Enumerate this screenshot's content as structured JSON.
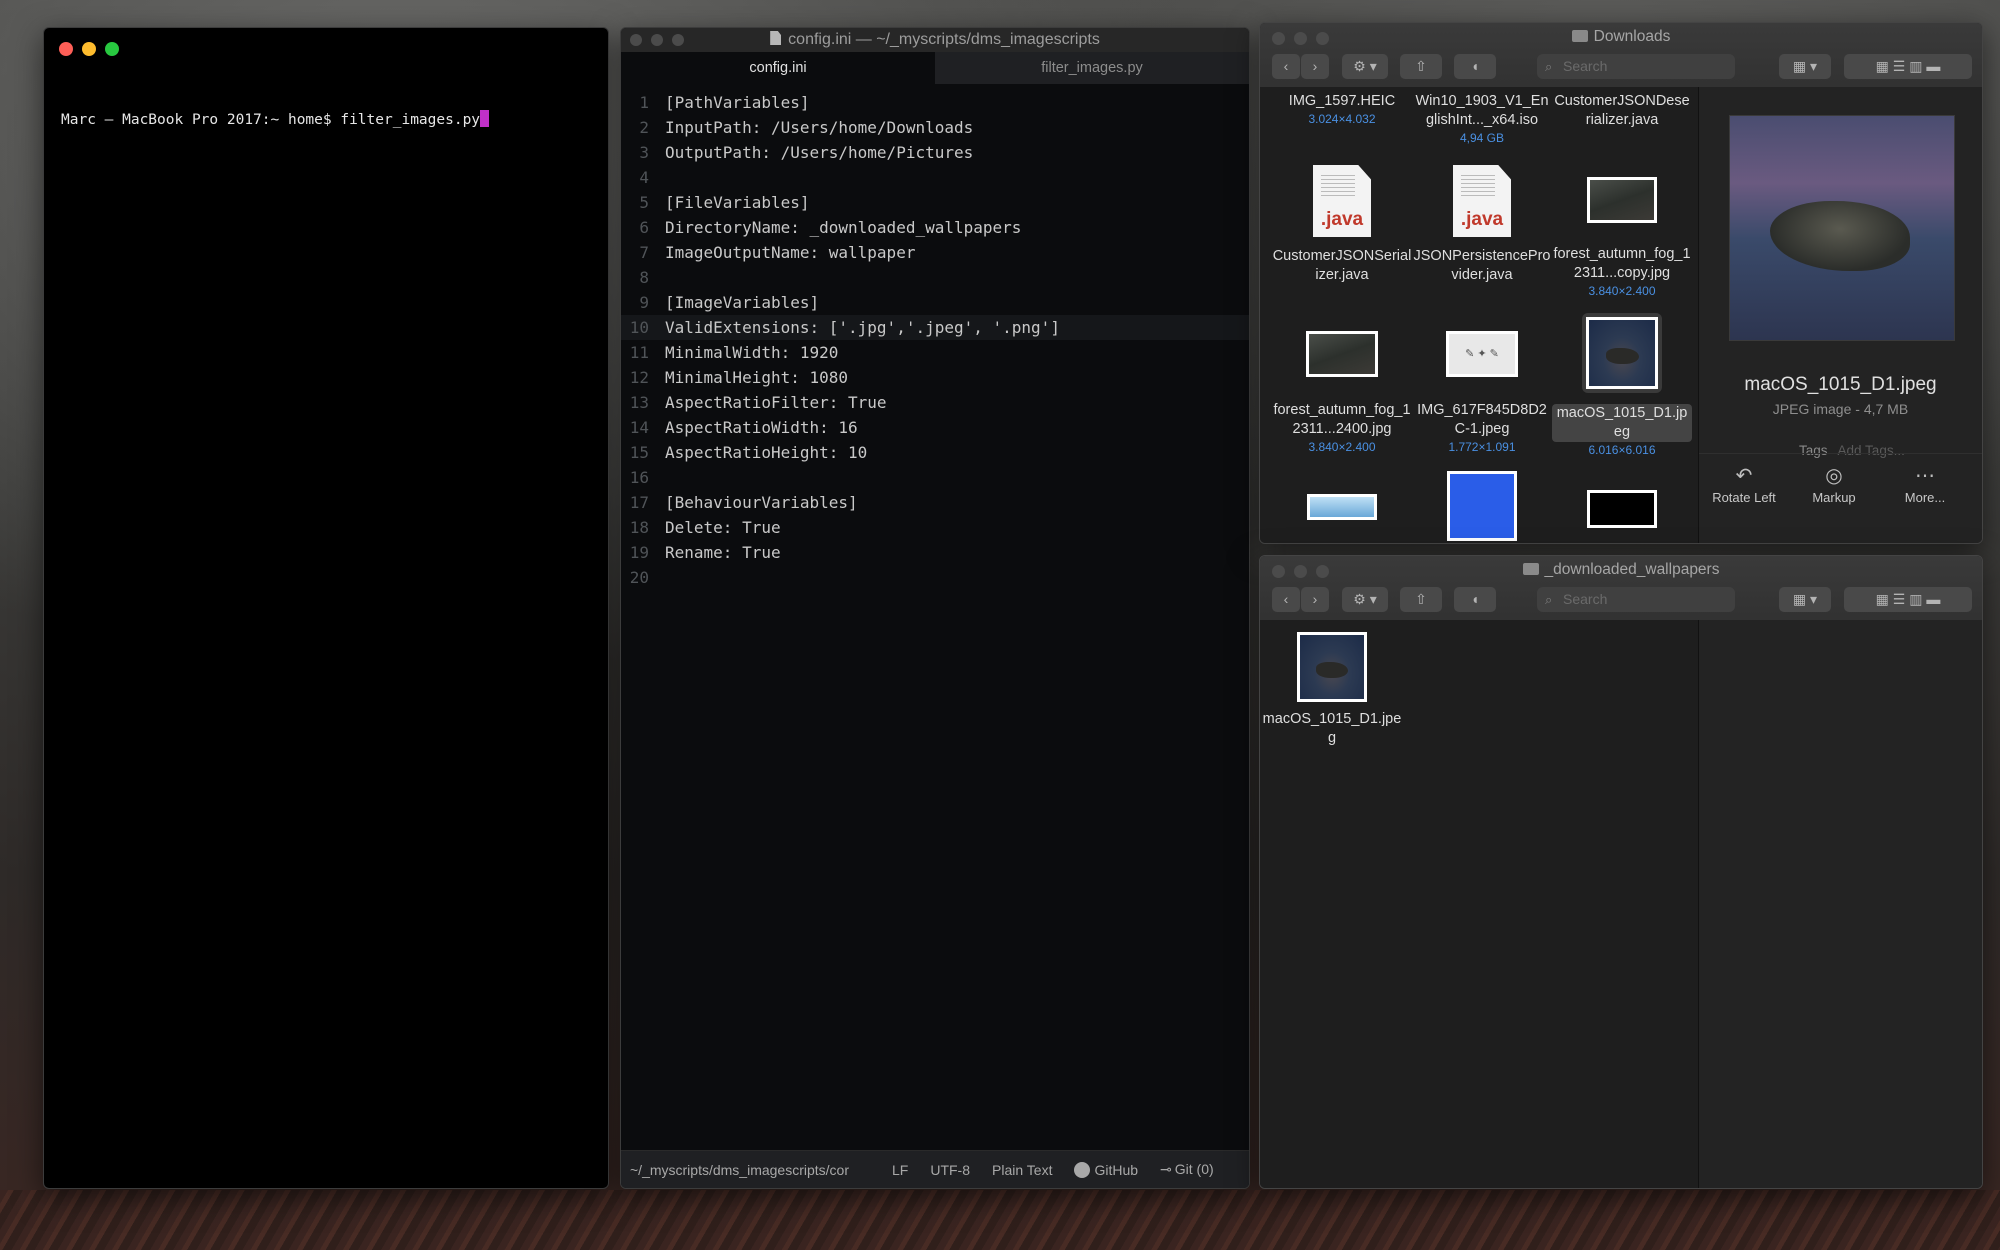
{
  "terminal": {
    "prompt": "Marc — MacBook Pro 2017:~ home$ filter_images.py"
  },
  "editor": {
    "title": "config.ini — ~/_myscripts/dms_imagescripts",
    "tabs": [
      "config.ini",
      "filter_images.py"
    ],
    "lines": [
      {
        "n": "1",
        "text": "[PathVariables]"
      },
      {
        "n": "2",
        "text": "InputPath: /Users/home/Downloads"
      },
      {
        "n": "3",
        "text": "OutputPath: /Users/home/Pictures"
      },
      {
        "n": "4",
        "text": ""
      },
      {
        "n": "5",
        "text": "[FileVariables]"
      },
      {
        "n": "6",
        "text": "DirectoryName: _downloaded_wallpapers"
      },
      {
        "n": "7",
        "text": "ImageOutputName: wallpaper"
      },
      {
        "n": "8",
        "text": ""
      },
      {
        "n": "9",
        "text": "[ImageVariables]"
      },
      {
        "n": "10",
        "text": "ValidExtensions: ['.jpg','.jpeg', '.png']"
      },
      {
        "n": "11",
        "text": "MinimalWidth: 1920"
      },
      {
        "n": "12",
        "text": "MinimalHeight: 1080"
      },
      {
        "n": "13",
        "text": "AspectRatioFilter: True"
      },
      {
        "n": "14",
        "text": "AspectRatioWidth: 16"
      },
      {
        "n": "15",
        "text": "AspectRatioHeight: 10"
      },
      {
        "n": "16",
        "text": ""
      },
      {
        "n": "17",
        "text": "[BehaviourVariables]"
      },
      {
        "n": "18",
        "text": "Delete: True"
      },
      {
        "n": "19",
        "text": "Rename: True"
      },
      {
        "n": "20",
        "text": ""
      }
    ],
    "status": {
      "path": "~/_myscripts/dms_imagescripts/cor",
      "line_ending": "LF",
      "encoding": "UTF-8",
      "grammar": "Plain Text",
      "github": "GitHub",
      "git": "Git (0)"
    }
  },
  "finder_downloads": {
    "title": "Downloads",
    "search_placeholder": "Search",
    "items": [
      {
        "name": "IMG_1597.HEIC",
        "sub": "3.024×4.032"
      },
      {
        "name": "Win10_1903_V1_EnglishInt..._x64.iso",
        "sub": "4,94 GB"
      },
      {
        "name": "CustomerJSONDeserializer.java",
        "sub": ""
      },
      {
        "name": "CustomerJSONSerializer.java",
        "sub": ""
      },
      {
        "name": "JSONPersistenceProvider.java",
        "sub": ""
      },
      {
        "name": "forest_autumn_fog_12311...copy.jpg",
        "sub": "3.840×2.400"
      },
      {
        "name": "forest_autumn_fog_12311...2400.jpg",
        "sub": "3.840×2.400"
      },
      {
        "name": "IMG_617F845D8D2C-1.jpeg",
        "sub": "1.772×1.091"
      },
      {
        "name": "macOS_1015_D1.jpeg",
        "sub": "6.016×6.016"
      }
    ],
    "java_label": ".java",
    "preview": {
      "name": "macOS_1015_D1.jpeg",
      "kind": "JPEG image - 4,7 MB",
      "tags_label": "Tags",
      "tags_placeholder": "Add Tags...",
      "actions": [
        "Rotate Left",
        "Markup",
        "More..."
      ]
    }
  },
  "finder_wallpapers": {
    "title": "_downloaded_wallpapers",
    "search_placeholder": "Search",
    "items": [
      {
        "name": "macOS_1015_D1.jpeg"
      }
    ]
  },
  "colors": {
    "terminal_bg": "#000000",
    "cursor": "#c030c8",
    "finder_sub": "#4a90e2",
    "java_red": "#c0392b"
  },
  "icons": [
    "close-dot",
    "minimize-dot",
    "zoom-dot",
    "back-chevron",
    "forward-chevron",
    "gear-icon",
    "share-icon",
    "tag-icon",
    "search-icon",
    "view-icons",
    "rotate-left-icon",
    "markup-icon",
    "more-icon",
    "github-icon",
    "git-icon"
  ]
}
